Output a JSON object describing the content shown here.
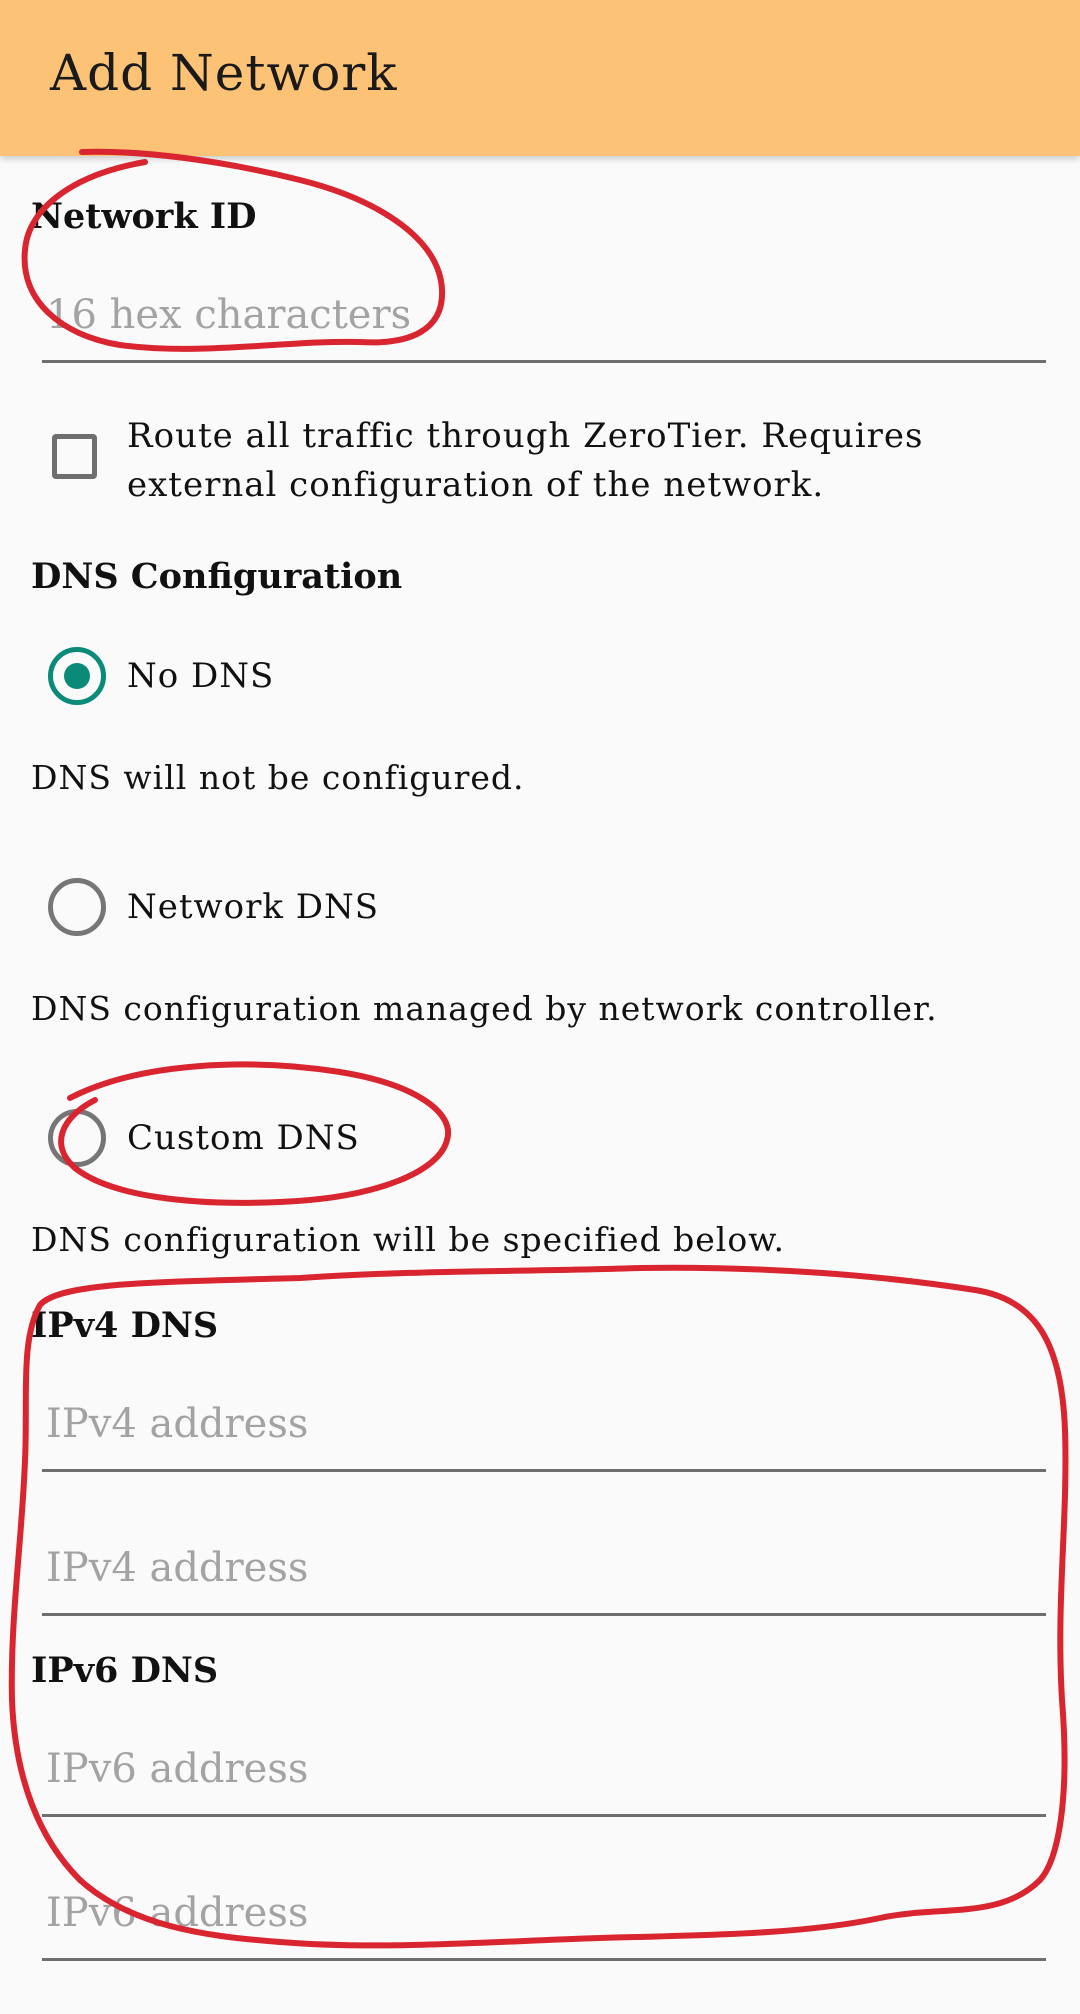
{
  "appbar": {
    "title": "Add Network"
  },
  "network_id": {
    "label": "Network ID",
    "placeholder": "16 hex characters",
    "value": ""
  },
  "route_all": {
    "label": "Route all traffic through ZeroTier. Requires external configuration of the network.",
    "checked": false
  },
  "dns": {
    "label": "DNS Configuration",
    "options": [
      {
        "label": "No DNS",
        "description": "DNS will not be configured.",
        "selected": true
      },
      {
        "label": "Network DNS",
        "description": "DNS configuration managed by network controller.",
        "selected": false
      },
      {
        "label": "Custom DNS",
        "description": "DNS configuration will be specified below.",
        "selected": false
      }
    ],
    "ipv4": {
      "label": "IPv4 DNS",
      "placeholder": "IPv4 address"
    },
    "ipv6": {
      "label": "IPv6 DNS",
      "placeholder": "IPv6 address"
    }
  },
  "colors": {
    "appbar": "#fcc276",
    "accent": "#0a8a78",
    "annotation": "#d9252f"
  }
}
